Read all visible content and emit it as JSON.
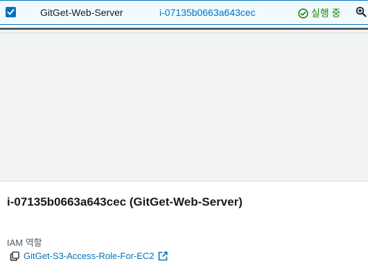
{
  "instance_row": {
    "name": "GitGet-Web-Server",
    "instance_id": "i-07135b0663a643cec",
    "state": "실행 중",
    "selected": true,
    "icons": {
      "checkbox": "checkbox-checked-icon",
      "state": "check-circle-icon",
      "zoom": "zoom-in-icon"
    }
  },
  "details": {
    "title": "i-07135b0663a643cec (GitGet-Web-Server)",
    "iam_role_label": "IAM 역할",
    "iam_role_value": "GitGet-S3-Access-Role-For-EC2",
    "icons": {
      "copy": "copy-icon",
      "external": "external-link-icon"
    }
  },
  "colors": {
    "link": "#0073bb",
    "running": "#1d8102",
    "selected_row_bg": "#f1faff",
    "panel_bg": "#f2f3f3",
    "text": "#16191f",
    "label": "#545b64"
  }
}
